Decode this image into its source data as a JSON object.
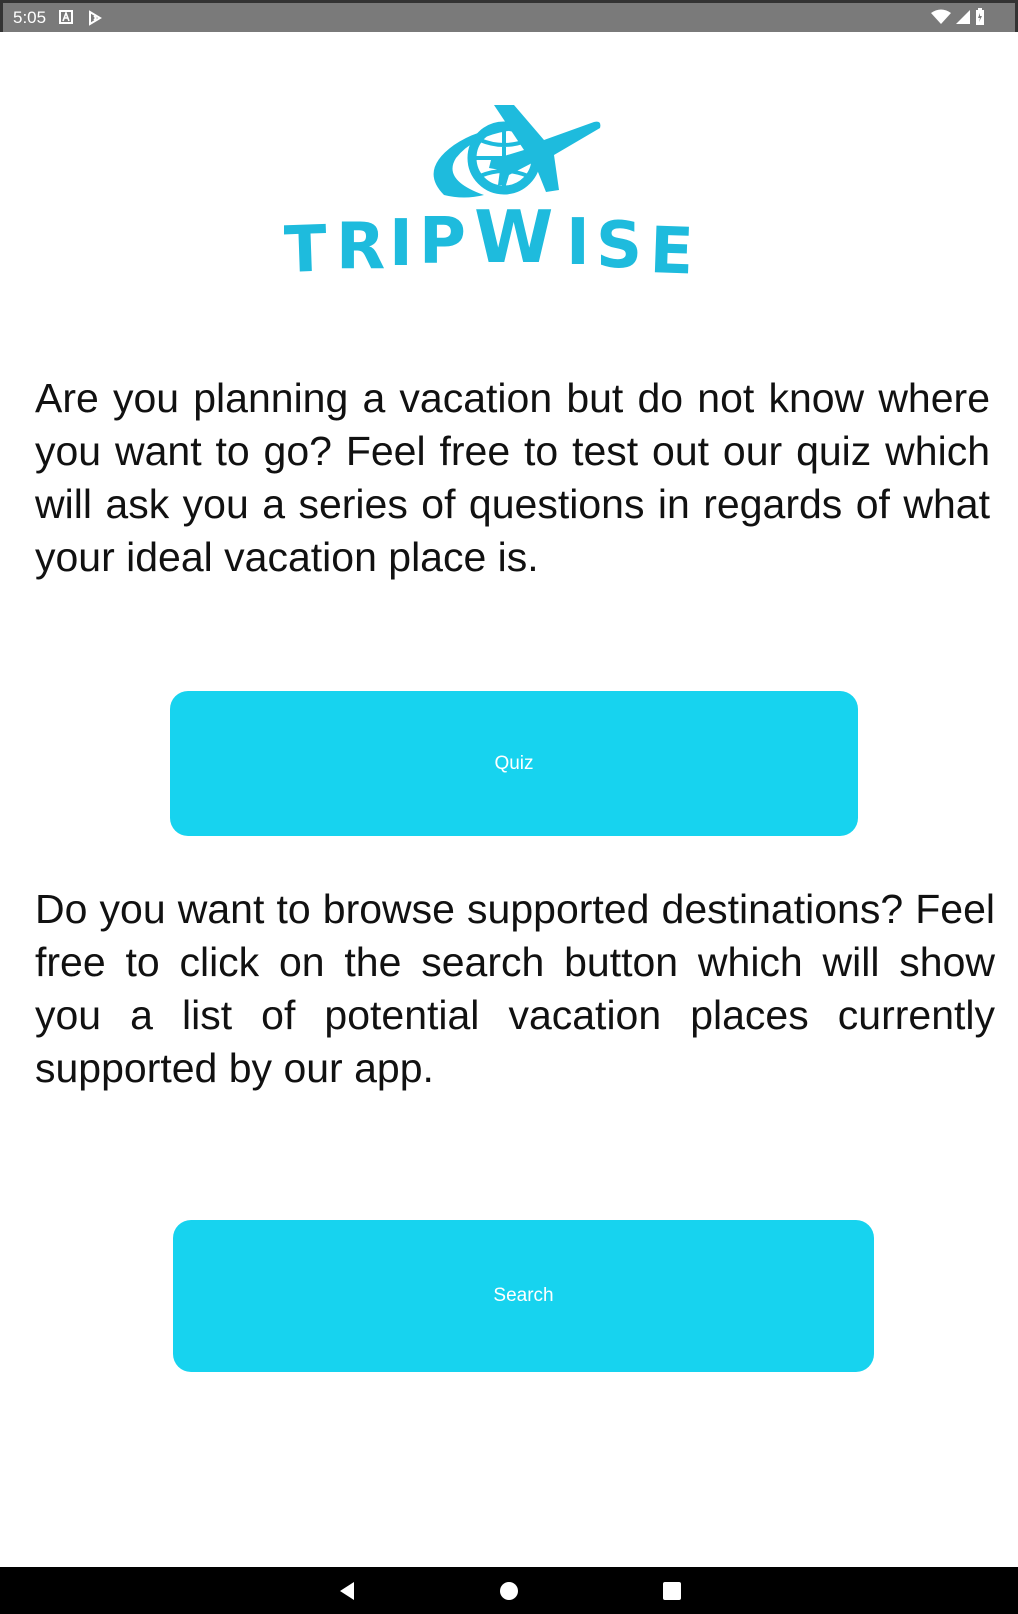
{
  "status_bar": {
    "time": "5:05",
    "left_icons": [
      "a-notification-icon",
      "play-store-icon"
    ],
    "right_icons": [
      "wifi-icon",
      "signal-icon",
      "battery-icon"
    ]
  },
  "logo": {
    "text": "TRIPWISE",
    "color": "#1ebbdd"
  },
  "intro": {
    "quiz_text": "Are you planning a vacation but do not know where you want to go? Feel free to test out our quiz which will ask you a series of questions in regards of what your ideal vacation place is.",
    "search_text": "Do you want to browse supported destinations? Feel free to click on the search button which will show you a list of potential vacation places currently supported by our app."
  },
  "buttons": {
    "quiz_label": "Quiz",
    "search_label": "Search",
    "color": "#17d3ef"
  },
  "nav_bar": {
    "icons": [
      "back-icon",
      "home-icon",
      "recents-icon"
    ]
  }
}
